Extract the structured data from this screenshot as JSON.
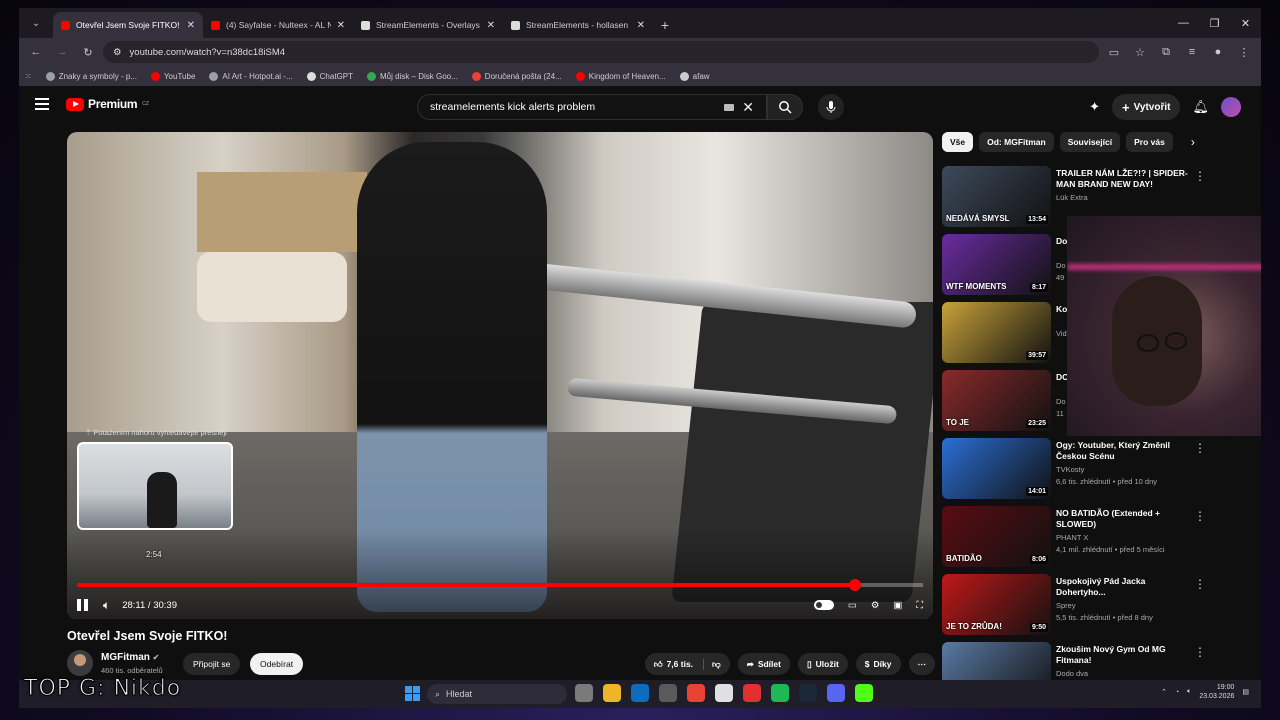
{
  "browser": {
    "tabs": [
      {
        "title": "Otevřel Jsem Svoje FITKO!",
        "active": true,
        "favicon_color": "#ff0000"
      },
      {
        "title": "(4) Sayfalse - Nulteex - AL NACI",
        "active": false,
        "favicon_color": "#ff0000"
      },
      {
        "title": "StreamElements - Overlays",
        "active": false,
        "favicon_color": "#dddddd"
      },
      {
        "title": "StreamElements - hollasen",
        "active": false,
        "favicon_color": "#dddddd"
      }
    ],
    "url": "youtube.com/watch?v=n38dc18iSM4",
    "bookmarks": [
      {
        "label": "Znaky a symboly - p...",
        "color": "#9aa0a6"
      },
      {
        "label": "YouTube",
        "color": "#ff0000"
      },
      {
        "label": "AI Art - Hotpot.ai -...",
        "color": "#9aa0a6"
      },
      {
        "label": "ChatGPT",
        "color": "#dddddd"
      },
      {
        "label": "Můj disk – Disk Goo...",
        "color": "#34a853"
      },
      {
        "label": "Doručená pošta (24...",
        "color": "#ea4335"
      },
      {
        "label": "Kingdom of Heaven...",
        "color": "#ff0000"
      },
      {
        "label": "afaw",
        "color": "#cccccc"
      }
    ]
  },
  "youtube": {
    "logo_text": "Premium",
    "logo_region": "CZ",
    "search_query": "streamelements kick alerts problem",
    "create_label": "Vytvořit"
  },
  "player": {
    "preview_hint": "Potažením nahoru vyhledávejte přesněji",
    "preview_time": "2:54",
    "current_time": "28:11",
    "total_time": "30:39",
    "progress_fraction": 0.92,
    "hover_fraction": 0.095
  },
  "video": {
    "title": "Otevřel Jsem Svoje FITKO!",
    "channel": "MGFitman",
    "subscribers": "460 tis. odběratelů",
    "join_label": "Připojit se",
    "subscribe_label": "Odebírat",
    "likes": "7,6 tis.",
    "share_label": "Sdílet",
    "save_label": "Uložit",
    "thanks_label": "Díky"
  },
  "sidebar": {
    "chips": [
      "Vše",
      "Od: MGFitman",
      "Související",
      "Pro vás"
    ],
    "recommendations": [
      {
        "title": "TRAILER NÁM LŽE?!? | SPIDER-MAN BRAND NEW DAY!",
        "channel": "Lük Extra",
        "meta": "",
        "duration": "13:54",
        "thumb": "#3d4a5c",
        "thumb_text": "NEDÁVÁ SMYSL"
      },
      {
        "title": "Do",
        "channel": "Do",
        "meta": "49",
        "duration": "8:17",
        "thumb": "#6a2ca0",
        "thumb_text": "WTF MOMENTS"
      },
      {
        "title": "Ko",
        "channel": "Vid",
        "meta": "",
        "duration": "39:57",
        "thumb": "#c9a23a",
        "thumb_text": ""
      },
      {
        "title": "DO",
        "channel": "Do",
        "meta": "11",
        "duration": "23:25",
        "thumb": "#8a2a2a",
        "thumb_text": "TO JE"
      },
      {
        "title": "Ogy: Youtuber, Který Změnil Českou Scénu",
        "channel": "TVKosty",
        "meta": "6,6 tis. zhlédnutí • před 10 dny",
        "duration": "14:01",
        "thumb": "#2b6fd6",
        "thumb_text": ""
      },
      {
        "title": "NO BATIDÃO (Extended + SLOWED)",
        "channel": "PHANT X",
        "meta": "4,1 mil. zhlédnutí • před 5 měsíci",
        "duration": "8:06",
        "thumb": "#5a0c12",
        "thumb_text": "BATIDÃO"
      },
      {
        "title": "Uspokojivý Pád Jacka Dohertyho...",
        "channel": "Sprey",
        "meta": "5,5 tis. zhlédnutí • před 8 dny",
        "duration": "9:50",
        "thumb": "#c01818",
        "thumb_text": "JE TO ZRŮDA!"
      },
      {
        "title": "Zkoušim Nový Gym Od MG Fitmana!",
        "channel": "Dodo dva",
        "meta": "",
        "duration": "",
        "thumb": "#5a7aa5",
        "thumb_text": ""
      }
    ]
  },
  "stream_overlay_text": "TOP G: Nikdo",
  "taskbar": {
    "search_placeholder": "Hledat",
    "time": "19:00",
    "date": "23.03.2026",
    "apps": [
      "#7a7a7a",
      "#f0b429",
      "#0f6cbd",
      "#5a5a5a",
      "#ea4335",
      "#e0e0e0",
      "#e03030",
      "#1db954",
      "#1b2838",
      "#5865f2",
      "#53fc18"
    ]
  }
}
